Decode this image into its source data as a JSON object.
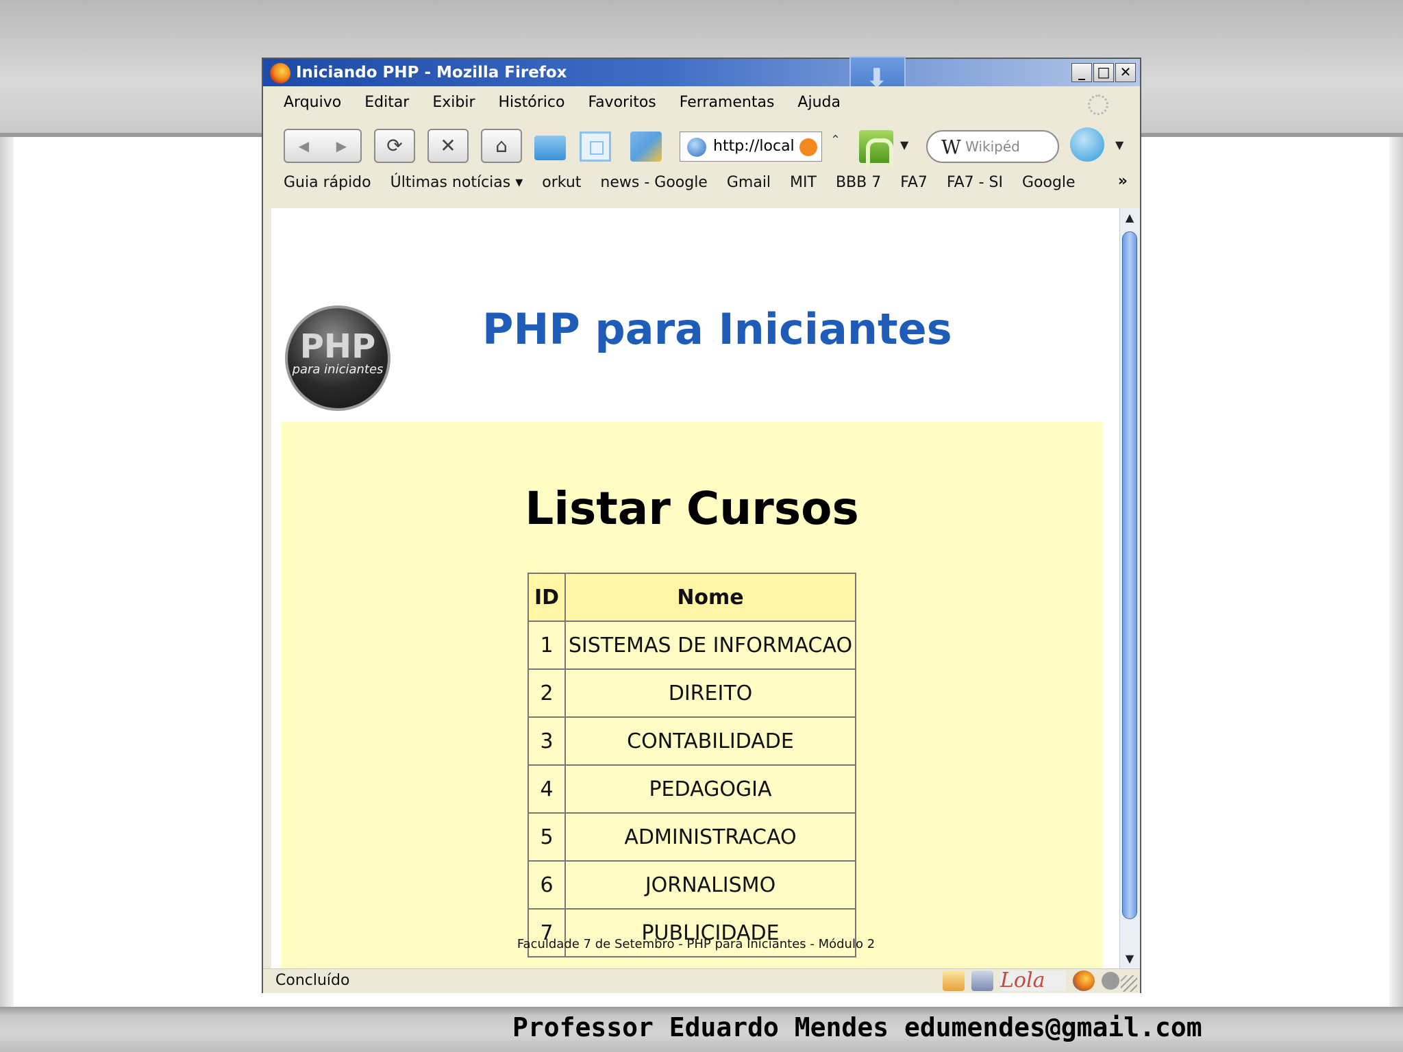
{
  "window": {
    "title": "Iniciando PHP - Mozilla Firefox",
    "buttons": {
      "minimize": "_",
      "maximize": "□",
      "close": "✕"
    }
  },
  "menu": [
    "Arquivo",
    "Editar",
    "Exibir",
    "Histórico",
    "Favoritos",
    "Ferramentas",
    "Ajuda"
  ],
  "navbar": {
    "url": "http://local",
    "search_placeholder": "Wikipéd"
  },
  "bookmarks": [
    "Guia rápido",
    "Últimas notícias ▾",
    "orkut",
    "news - Google",
    "Gmail",
    "MIT",
    "BBB 7",
    "FA7",
    "FA7 - SI",
    "Google"
  ],
  "bookmarks_more": "»",
  "page": {
    "logo_big": "PHP",
    "logo_small": "para iniciantes",
    "site_title": "PHP para Iniciantes",
    "list_title": "Listar Cursos",
    "table_headers": {
      "id": "ID",
      "nome": "Nome"
    },
    "rows": [
      {
        "id": "1",
        "nome": "SISTEMAS DE INFORMACAO"
      },
      {
        "id": "2",
        "nome": "DIREITO"
      },
      {
        "id": "3",
        "nome": "CONTABILIDADE"
      },
      {
        "id": "4",
        "nome": "PEDAGOGIA"
      },
      {
        "id": "5",
        "nome": "ADMINISTRACAO"
      },
      {
        "id": "6",
        "nome": "JORNALISMO"
      },
      {
        "id": "7",
        "nome": "PUBLICIDADE"
      }
    ],
    "footer": "Faculdade 7 de Setembro - PHP para Iniciantes - Módulo 2"
  },
  "status": {
    "text": "Concluído",
    "lola": "Lola"
  },
  "slide": {
    "footer": "Professor Eduardo Mendes edumendes@gmail.com"
  }
}
